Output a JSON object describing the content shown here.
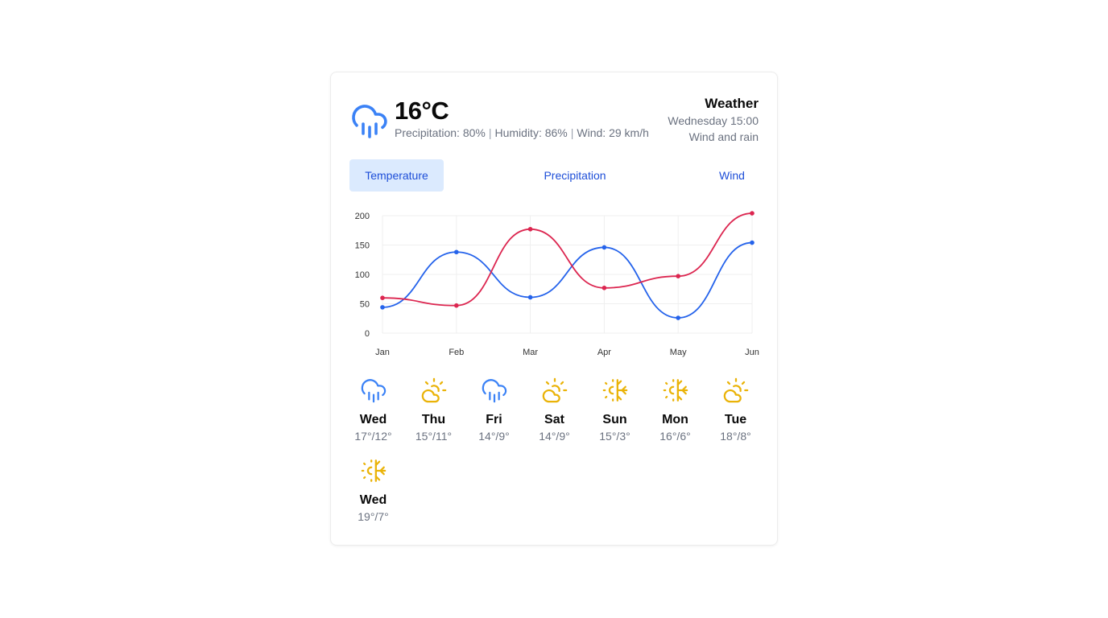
{
  "current": {
    "temperature": "16°C",
    "icon": "rain-icon",
    "precipitation": "Precipitation: 80%",
    "humidity": "Humidity: 86%",
    "wind": "Wind: 29 km/h",
    "separator": "|"
  },
  "header": {
    "title": "Weather",
    "datetime": "Wednesday 15:00",
    "condition": "Wind and rain"
  },
  "tabs": [
    {
      "label": "Temperature",
      "active": true
    },
    {
      "label": "Precipitation",
      "active": false
    },
    {
      "label": "Wind",
      "active": false
    }
  ],
  "colors": {
    "accent": "#1d4ed8",
    "rain_icon": "#3b82f6",
    "sun_icon": "#eab308",
    "series_blue": "#2563eb",
    "series_red": "#dc2650"
  },
  "chart_data": {
    "type": "line",
    "categories": [
      "Jan",
      "Feb",
      "Mar",
      "Apr",
      "May",
      "Jun"
    ],
    "yticks": [
      "0",
      "50",
      "100",
      "150",
      "200"
    ],
    "ylim": [
      0,
      200
    ],
    "grid": true,
    "series": [
      {
        "color": "#2563eb",
        "values": [
          44,
          138,
          61,
          146,
          26,
          154
        ]
      },
      {
        "color": "#dc2650",
        "values": [
          60,
          47,
          177,
          77,
          97,
          204
        ]
      }
    ]
  },
  "forecast": [
    {
      "day": "Wed",
      "temps": "17°/12°",
      "icon": "rain-icon"
    },
    {
      "day": "Thu",
      "temps": "15°/11°",
      "icon": "cloud-icon"
    },
    {
      "day": "Fri",
      "temps": "14°/9°",
      "icon": "rain-icon"
    },
    {
      "day": "Sat",
      "temps": "14°/9°",
      "icon": "cloud-icon"
    },
    {
      "day": "Sun",
      "temps": "15°/3°",
      "icon": "sun-snow-icon"
    },
    {
      "day": "Mon",
      "temps": "16°/6°",
      "icon": "sun-snow-icon"
    },
    {
      "day": "Tue",
      "temps": "18°/8°",
      "icon": "cloud-icon"
    },
    {
      "day": "Wed",
      "temps": "19°/7°",
      "icon": "sun-snow-icon"
    }
  ]
}
